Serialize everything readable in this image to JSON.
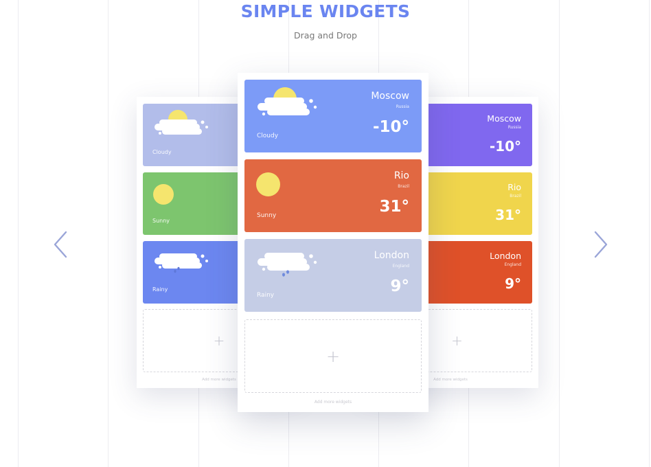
{
  "hero": {
    "title": "SIMPLE WIDGETS",
    "subtitle": "Drag and Drop"
  },
  "nav": {
    "prev_icon": "chevron-left-icon",
    "next_icon": "chevron-right-icon"
  },
  "colors": {
    "title": "#6a85f0",
    "sun": "#f5e56e",
    "arrow": "#9aa5d8"
  },
  "left_phone": {
    "widgets": [
      {
        "condition": "Cloudy",
        "color": "#b2bdea",
        "icon": "cloud-sun-icon"
      },
      {
        "condition": "Sunny",
        "color": "#7dc56e",
        "icon": "sun-icon"
      },
      {
        "condition": "Rainy",
        "color": "#6c87f0",
        "icon": "rain-cloud-icon"
      }
    ],
    "add_label": "Add more widgets"
  },
  "center_phone": {
    "widgets": [
      {
        "city": "Moscow",
        "country": "Russia",
        "temp": "-10°",
        "condition": "Cloudy",
        "color": "#7c9bf7",
        "icon": "cloud-sun-icon"
      },
      {
        "city": "Rio",
        "country": "Brazil",
        "temp": "31°",
        "condition": "Sunny",
        "color": "#e16842",
        "icon": "sun-icon"
      },
      {
        "city": "London",
        "country": "England",
        "temp": "9°",
        "condition": "Rainy",
        "color": "#c5cde6",
        "icon": "rain-cloud-icon"
      }
    ],
    "add_label": "Add more widgets"
  },
  "right_phone": {
    "widgets": [
      {
        "city": "Moscow",
        "country": "Russia",
        "temp": "-10°",
        "color": "#8068ef"
      },
      {
        "city": "Rio",
        "country": "Brazil",
        "temp": "31°",
        "color": "#f0d54c"
      },
      {
        "city": "London",
        "country": "England",
        "temp": "9°",
        "color": "#df5129"
      }
    ],
    "add_label": "Add more widgets"
  }
}
